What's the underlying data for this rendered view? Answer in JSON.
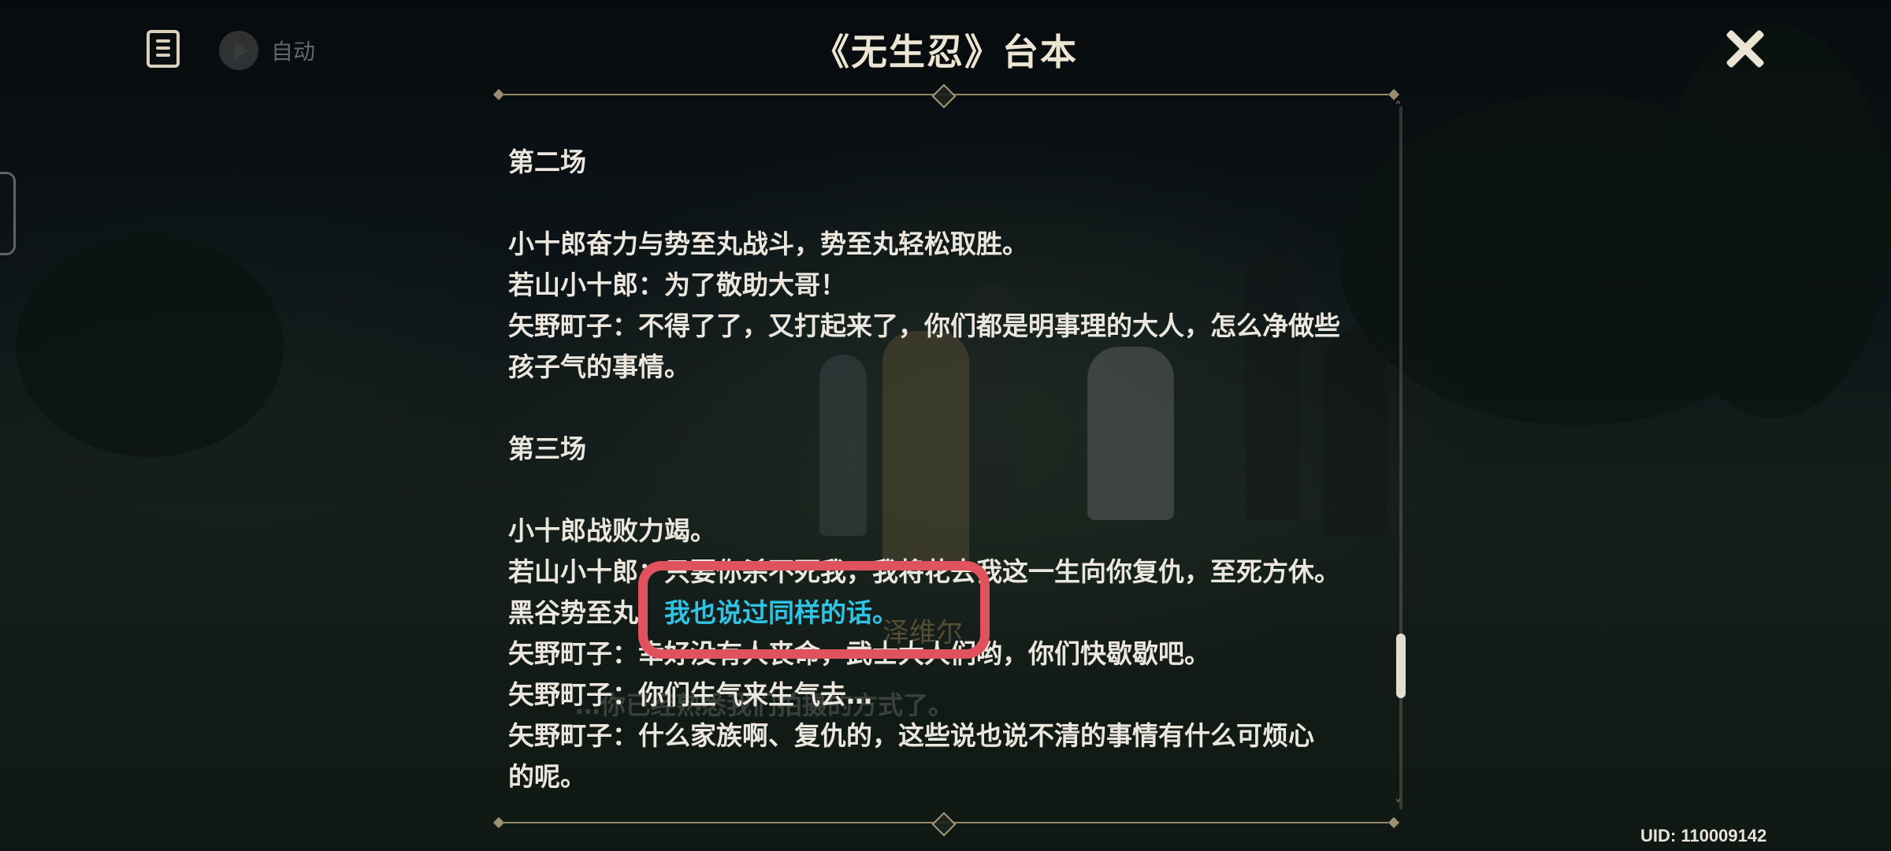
{
  "header": {
    "title": "《无生忍》台本",
    "auto_label": "自动"
  },
  "script": {
    "scene2_heading": "第二场",
    "scene2_lines": [
      "小十郎奋力与势至丸战斗，势至丸轻松取胜。",
      "若山小十郎：为了敬助大哥！",
      "矢野町子：不得了了，又打起来了，你们都是明事理的大人，怎么净做些",
      "孩子气的事情。"
    ],
    "scene3_heading": "第三场",
    "scene3_lines": [
      "小十郎战败力竭。",
      "若山小十郎：只要你杀不死我，我将花去我这一生向你复仇，至死方休。",
      "矢野町子：幸好没有人丧命，武士大人们哟，你们快歇歇吧。",
      "矢野町子：你们生气来生气去…",
      "矢野町子：什么家族啊、复仇的，这些说也说不清的事情有什么可烦心",
      "的呢。"
    ],
    "highlight_speaker": "黑谷势至丸：",
    "highlight_text": "我也说过同样的话。"
  },
  "background": {
    "ghost_subtitle": "…你已经熟悉我们拍摄的方式了。",
    "ghost_name": "泽维尔"
  },
  "footer": {
    "uid": "UID: 110009142"
  },
  "colors": {
    "highlight_text": "#2fc4e3",
    "highlight_frame": "#e0525e",
    "accent_gold": "#bfae8c"
  },
  "icons": {
    "story_log": "document-icon",
    "auto_play": "play-icon",
    "close": "close-icon"
  }
}
